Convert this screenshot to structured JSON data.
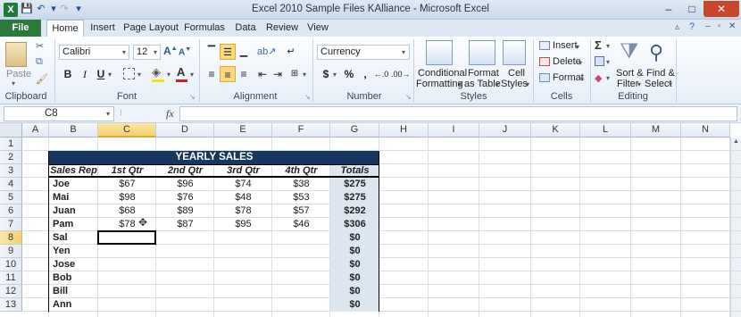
{
  "window": {
    "title": "Excel 2010 Sample Files KAlliance  -  Microsoft Excel",
    "minimize": "–",
    "maximize": "□",
    "close": "✕"
  },
  "tabs": [
    "File",
    "Home",
    "Insert",
    "Page Layout",
    "Formulas",
    "Data",
    "Review",
    "View"
  ],
  "ribbon": {
    "clipboard": {
      "label": "Clipboard",
      "paste": "Paste"
    },
    "font": {
      "label": "Font",
      "name": "Calibri",
      "size": "12",
      "bold": "B",
      "italic": "I",
      "underline": "U"
    },
    "alignment": {
      "label": "Alignment"
    },
    "number": {
      "label": "Number",
      "format": "Currency",
      "dollar": "$",
      "percent": "%",
      "comma": ","
    },
    "styles": {
      "label": "Styles",
      "conditional": [
        "Conditional",
        "Formatting"
      ],
      "format_table": [
        "Format",
        "as Table"
      ],
      "cell_styles": [
        "Cell",
        "Styles"
      ]
    },
    "cells": {
      "label": "Cells",
      "insert": "Insert",
      "delete": "Delete",
      "format": "Format"
    },
    "editing": {
      "label": "Editing",
      "sum": "Σ",
      "sort": [
        "Sort &",
        "Filter"
      ],
      "find": [
        "Find &",
        "Select"
      ]
    }
  },
  "formula_bar": {
    "name_box": "C8",
    "fx": "fx",
    "value": ""
  },
  "columns": [
    "A",
    "B",
    "C",
    "D",
    "E",
    "F",
    "G",
    "H",
    "I",
    "J",
    "K",
    "L",
    "M",
    "N"
  ],
  "rows": [
    "1",
    "2",
    "3",
    "4",
    "5",
    "6",
    "7",
    "8",
    "9",
    "10",
    "11",
    "12",
    "13"
  ],
  "sheet": {
    "title": "YEARLY SALES",
    "headers": [
      "Sales Rep",
      "1st Qtr",
      "2nd Qtr",
      "3rd Qtr",
      "4th Qtr",
      "Totals"
    ],
    "data": [
      [
        "Joe",
        "$67",
        "$96",
        "$74",
        "$38",
        "$275"
      ],
      [
        "Mai",
        "$98",
        "$76",
        "$48",
        "$53",
        "$275"
      ],
      [
        "Juan",
        "$68",
        "$89",
        "$78",
        "$57",
        "$292"
      ],
      [
        "Pam",
        "$78",
        "$87",
        "$95",
        "$46",
        "$306"
      ],
      [
        "Sal",
        "",
        "",
        "",
        "",
        "$0"
      ],
      [
        "Yen",
        "",
        "",
        "",
        "",
        "$0"
      ],
      [
        "Jose",
        "",
        "",
        "",
        "",
        "$0"
      ],
      [
        "Bob",
        "",
        "",
        "",
        "",
        "$0"
      ],
      [
        "Bill",
        "",
        "",
        "",
        "",
        "$0"
      ],
      [
        "Ann",
        "",
        "",
        "",
        "",
        "$0"
      ]
    ]
  },
  "selected_cell": "C8",
  "colors": {
    "header_band": "#17375e",
    "totals_fill": "#dce6f1",
    "selection": "#000000"
  }
}
